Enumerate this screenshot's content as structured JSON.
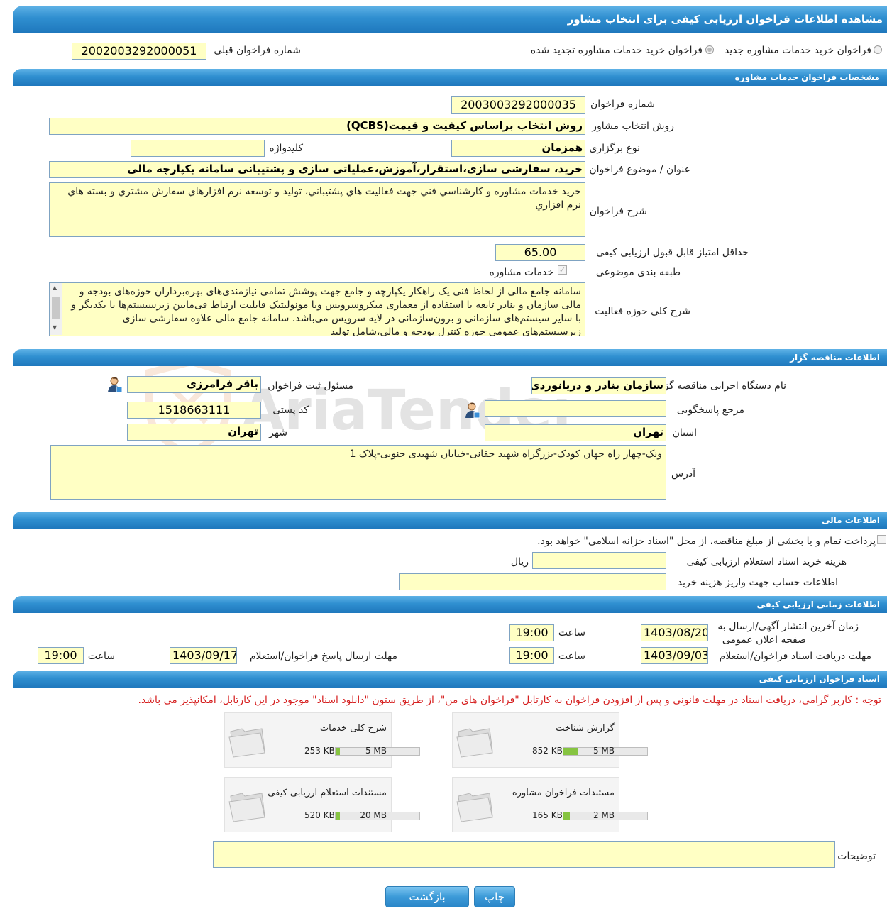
{
  "header": {
    "title": "مشاهده اطلاعات فراخوان ارزیابی کیفی برای انتخاب مشاور"
  },
  "top": {
    "radio_new": "فراخوان خرید خدمات مشاوره جدید",
    "radio_renewed": "فراخوان خرید خدمات مشاوره تجدید شده",
    "prev_number_label": "شماره فراخوان قبلی",
    "prev_number_value": "2002003292000051"
  },
  "spec": {
    "section_title": "مشخصات فراخوان خدمات مشاوره",
    "number_label": "شماره فراخوان",
    "number_value": "2003003292000035",
    "method_label": "روش انتخاب مشاور",
    "method_value": "روش انتخاب براساس کیفیت و قیمت(QCBS)",
    "type_label": "نوع برگزاری",
    "type_value": "همزمان",
    "keyword_label": "کلیدواژه",
    "keyword_value": "",
    "subject_label": "عنوان / موضوع فراخوان",
    "subject_value": "خرید، سفارشی سازی،استقرار،آموزش،عملیاتی سازی و پشتیبانی سامانه یکپارچه مالی",
    "desc_label": "شرح فراخوان",
    "desc_value": "خريد خدمات مشاوره و كارشناسي فني جهت فعاليت هاي پشتيباني، توليد و توسعه نرم افزارهاي سفارش مشتري و بسته هاي نرم افزاري",
    "min_score_label": "حداقل امتیاز قابل قبول ارزیابی کیفی",
    "min_score_value": "65.00",
    "category_label": "طبقه بندی موضوعی",
    "category_value": "خدمات مشاوره",
    "scope_label": "شرح کلی حوزه فعالیت",
    "scope_value": "سامانه جامع مالی از لحاظ فنی یک راهکار یکپارچه و جامع جهت پوشش تمامی نیازمندی‌های بهره‌برداران حوزه‌های بودجه و مالی سازمان و بنادر تابعه با استفاده از معماری میکروسرویس ویا مونولیتیک قابلیت ارتباط فی‌مابین زیرسیستم‌ها با یکدیگر و با سایر سیستم‌های سازمانی و برون‌سازمانی در لایه سرویس می‌باشد. سامانه جامع مالی علاوه سفارشی سازی زیرسیستم‌های عمومی حوزه کنترل بودجه و مالی،شامل تولید"
  },
  "tenderer": {
    "section_title": "اطلاعات مناقصه گزار",
    "org_label": "نام دستگاه اجرایی مناقصه گزار",
    "org_value": "سازمان بنادر و دریانوردی",
    "registrar_label": "مسئول ثبت فراخوان",
    "registrar_value": "باقر فرامرزی",
    "ref_label": "مرجع پاسخگویی",
    "ref_value": "",
    "postal_label": "کد پستی",
    "postal_value": "1518663111",
    "province_label": "استان",
    "province_value": "تهران",
    "city_label": "شهر",
    "city_value": "تهران",
    "address_label": "آدرس",
    "address_value": "ونک-چهار راه جهان کودک-بزرگراه شهید حقانی-خیابان شهیدی جنوبی-پلاک 1"
  },
  "finance": {
    "section_title": "اطلاعات مالی",
    "treasury_text": "پرداخت تمام و یا بخشی از مبلغ مناقصه، از محل \"اسناد خزانه اسلامی\" خواهد بود.",
    "doc_cost_label": "هزینه خرید اسناد استعلام ارزیابی کیفی",
    "doc_cost_value": "",
    "currency": "ریال",
    "account_label": "اطلاعات حساب جهت واریز هزینه خرید",
    "account_value": ""
  },
  "timing": {
    "section_title": "اطلاعات زمانی ارزیابی کیفی",
    "publish_label_1": "زمان آخرین انتشار آگهی/ارسال به",
    "publish_label_2": "صفحه اعلان عمومی",
    "publish_date": "1403/08/20",
    "time_label": "ساعت",
    "publish_time": "19:00",
    "receive_label": "مهلت دریافت اسناد فراخوان/استعلام",
    "receive_date": "1403/09/03",
    "receive_time": "19:00",
    "submit_label": "مهلت ارسال پاسخ فراخوان/استعلام",
    "submit_date": "1403/09/17",
    "submit_time": "19:00"
  },
  "documents": {
    "section_title": "اسناد فراخوان ارزیابی کیفی",
    "note": "توجه : کاربر گرامی، دریافت اسناد در مهلت قانونی و پس از افزودن فراخوان به کارتابل \"فراخوان های من\"، از طریق ستون \"دانلود اسناد\" موجود در این کارتابل، امکانپذیر می باشد.",
    "files": [
      {
        "title": "گزارش شناخت",
        "size": "852 KB",
        "max": "5 MB",
        "fraction": 0.166
      },
      {
        "title": "شرح کلی خدمات",
        "size": "253 KB",
        "max": "5 MB",
        "fraction": 0.05
      },
      {
        "title": "مستندات فراخوان مشاوره",
        "size": "165 KB",
        "max": "2 MB",
        "fraction": 0.08
      },
      {
        "title": "مستندات استعلام ارزیابی کیفی",
        "size": "520 KB",
        "max": "20 MB",
        "fraction": 0.026
      }
    ],
    "notes_label": "توضیحات",
    "notes_value": ""
  },
  "actions": {
    "print": "چاپ",
    "back": "بازگشت"
  },
  "watermark": "AriaTender.neT",
  "colors": {
    "bar": "#2f8fd0",
    "field_bg": "#ffffc4",
    "progress": "#86c441",
    "note": "#d62020"
  }
}
